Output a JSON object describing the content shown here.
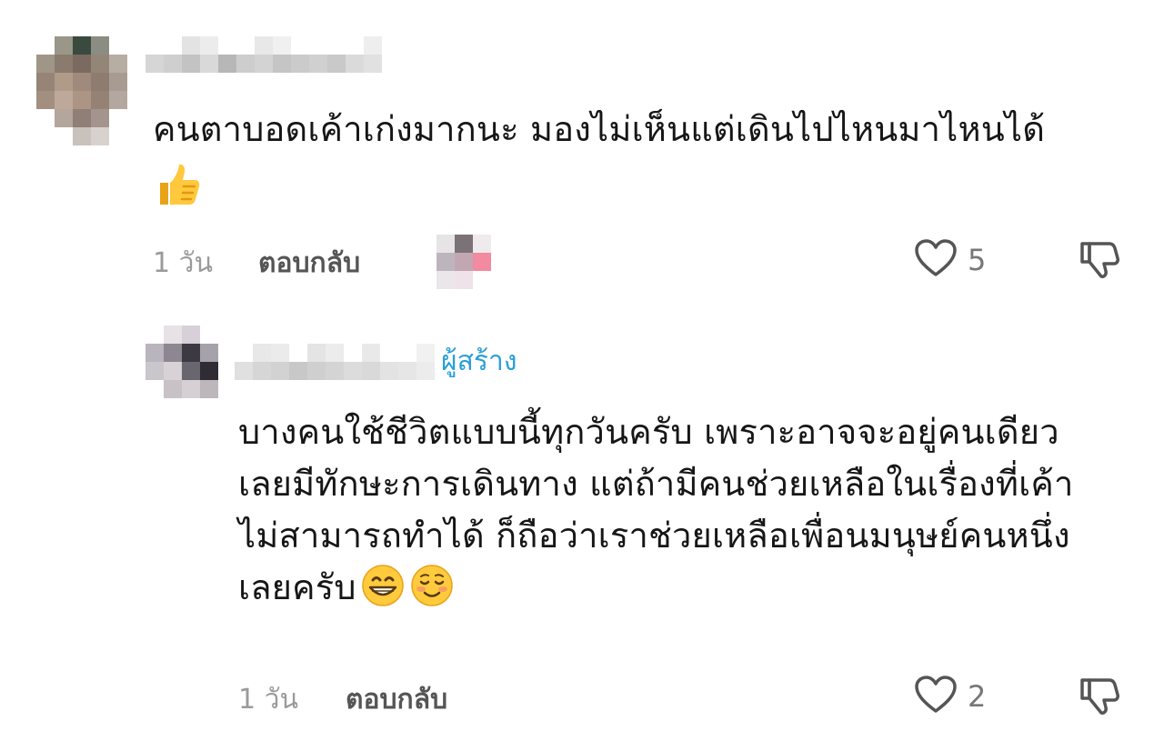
{
  "comments": [
    {
      "text": "คนตาบอดเค้าเก่งมากนะ มองไม่เห็นแต่เดินไปไหนมาไหนได้",
      "time": "1 วัน",
      "reply_label": "ตอบกลับ",
      "likes": "5",
      "emoji": "thumbs-up-emoji",
      "author_avatar": "pixelated",
      "author_name": "pixelated"
    },
    {
      "text": "บางคนใช้ชีวิตแบบนี้ทุกวันครับ เพราะอาจจะอยู่คนเดียว เลยมีทักษะการเดินทาง แต่ถ้ามีคนช่วยเหลือในเรื่องที่เค้าไม่สามารถทำได้ ก็ถือว่าเราช่วยเหลือเพื่อนมนุษย์คนหนึ่งเลยครับ",
      "creator_tag": "ผู้สร้าง",
      "time": "1 วัน",
      "reply_label": "ตอบกลับ",
      "likes": "2",
      "emojis": [
        "grinning-face-emoji",
        "smiling-face-emoji"
      ],
      "author_avatar": "pixelated",
      "author_name": "pixelated"
    }
  ],
  "icons": {
    "like": "heart-outline-icon",
    "dislike": "thumbs-down-outline-icon"
  },
  "colors": {
    "creator_tag": "#2a9fd6",
    "meta_text": "#9a9a9a",
    "reply_text": "#555555",
    "icon": "#555555"
  }
}
